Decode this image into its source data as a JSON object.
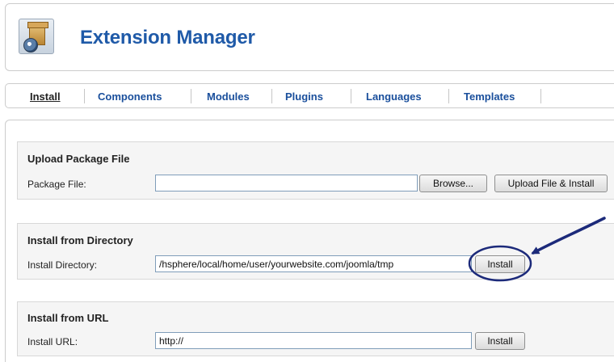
{
  "header": {
    "title": "Extension Manager",
    "icon": "extension-box-icon"
  },
  "tabs": [
    {
      "label": "Install",
      "active": true
    },
    {
      "label": "Components",
      "active": false
    },
    {
      "label": "Modules",
      "active": false
    },
    {
      "label": "Plugins",
      "active": false
    },
    {
      "label": "Languages",
      "active": false
    },
    {
      "label": "Templates",
      "active": false
    }
  ],
  "upload": {
    "title": "Upload Package File",
    "label": "Package File:",
    "value": "",
    "browse_label": "Browse...",
    "submit_label": "Upload File & Install"
  },
  "directory": {
    "title": "Install from Directory",
    "label": "Install Directory:",
    "value": "/hsphere/local/home/user/yourwebsite.com/joomla/tmp",
    "submit_label": "Install"
  },
  "url": {
    "title": "Install from URL",
    "label": "Install URL:",
    "value": "http://",
    "submit_label": "Install"
  },
  "colors": {
    "title": "#1f5aa8",
    "tab_link": "#1a4f9c",
    "annotation": "#1c2a7a"
  }
}
